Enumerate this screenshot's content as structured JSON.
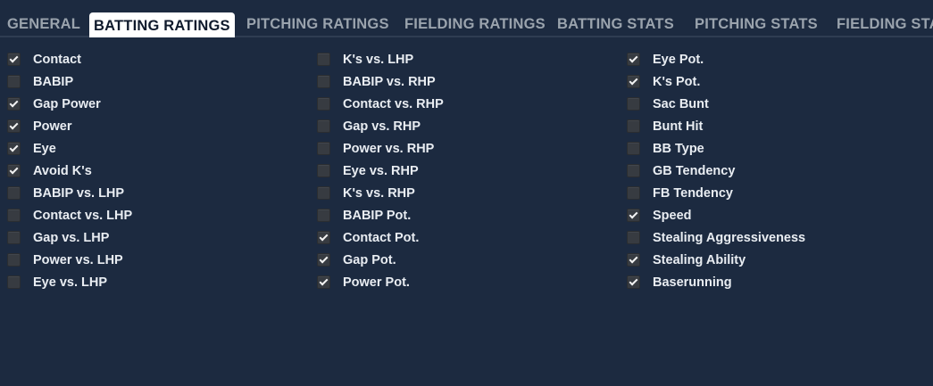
{
  "tabs": [
    {
      "label": "GENERAL",
      "active": false
    },
    {
      "label": "BATTING RATINGS",
      "active": true
    },
    {
      "label": "PITCHING RATINGS",
      "active": false
    },
    {
      "label": "FIELDING RATINGS",
      "active": false
    },
    {
      "label": "BATTING STATS",
      "active": false
    },
    {
      "label": "PITCHING STATS",
      "active": false
    },
    {
      "label": "FIELDING STA",
      "active": false
    }
  ],
  "columns": [
    [
      {
        "label": "Contact",
        "checked": true
      },
      {
        "label": "BABIP",
        "checked": false
      },
      {
        "label": "Gap Power",
        "checked": true
      },
      {
        "label": "Power",
        "checked": true
      },
      {
        "label": "Eye",
        "checked": true
      },
      {
        "label": "Avoid K's",
        "checked": true
      },
      {
        "label": "BABIP vs. LHP",
        "checked": false
      },
      {
        "label": "Contact vs. LHP",
        "checked": false
      },
      {
        "label": "Gap vs. LHP",
        "checked": false
      },
      {
        "label": "Power vs. LHP",
        "checked": false
      },
      {
        "label": "Eye vs. LHP",
        "checked": false
      }
    ],
    [
      {
        "label": "K's vs. LHP",
        "checked": false
      },
      {
        "label": "BABIP vs. RHP",
        "checked": false
      },
      {
        "label": "Contact vs. RHP",
        "checked": false
      },
      {
        "label": "Gap vs. RHP",
        "checked": false
      },
      {
        "label": "Power vs. RHP",
        "checked": false
      },
      {
        "label": "Eye vs. RHP",
        "checked": false
      },
      {
        "label": "K's vs. RHP",
        "checked": false
      },
      {
        "label": "BABIP Pot.",
        "checked": false
      },
      {
        "label": "Contact Pot.",
        "checked": true
      },
      {
        "label": "Gap Pot.",
        "checked": true
      },
      {
        "label": "Power Pot.",
        "checked": true
      }
    ],
    [
      {
        "label": "Eye Pot.",
        "checked": true
      },
      {
        "label": "K's Pot.",
        "checked": true
      },
      {
        "label": "Sac Bunt",
        "checked": false
      },
      {
        "label": "Bunt Hit",
        "checked": false
      },
      {
        "label": "BB Type",
        "checked": false
      },
      {
        "label": "GB Tendency",
        "checked": false
      },
      {
        "label": "FB Tendency",
        "checked": false
      },
      {
        "label": "Speed",
        "checked": true
      },
      {
        "label": "Stealing Aggressiveness",
        "checked": false
      },
      {
        "label": "Stealing Ability",
        "checked": true
      },
      {
        "label": "Baserunning",
        "checked": true
      }
    ]
  ]
}
